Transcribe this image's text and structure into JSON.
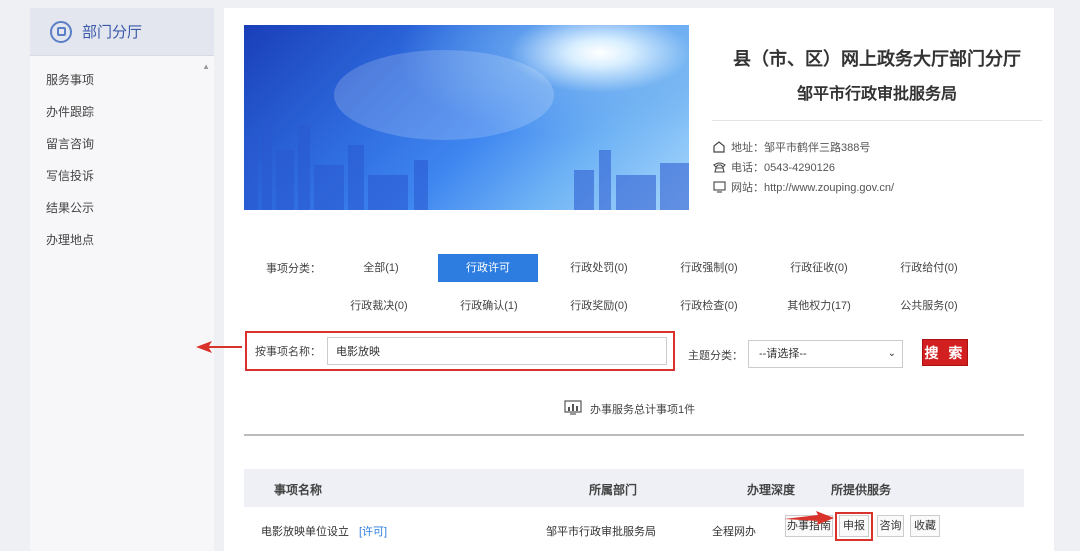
{
  "sidebar": {
    "title": "部门分厅",
    "items": [
      {
        "label": "服务事项"
      },
      {
        "label": "办件跟踪"
      },
      {
        "label": "留言咨询"
      },
      {
        "label": "写信投诉"
      },
      {
        "label": "结果公示"
      },
      {
        "label": "办理地点"
      }
    ]
  },
  "dept": {
    "title": "县（市、区）网上政务大厅部门分厅",
    "subtitle": "邹平市行政审批服务局",
    "address": "地址：邹平市鹤伴三路388号",
    "phone": "电话：0543-4290126",
    "website": "网站：http://www.zouping.gov.cn/"
  },
  "categories": {
    "label": "事项分类：",
    "items": [
      {
        "label": "全部(1)"
      },
      {
        "label": "行政许可"
      },
      {
        "label": "行政处罚(0)"
      },
      {
        "label": "行政强制(0)"
      },
      {
        "label": "行政征收(0)"
      },
      {
        "label": "行政给付(0)"
      },
      {
        "label": "行政裁决(0)"
      },
      {
        "label": "行政确认(1)"
      },
      {
        "label": "行政奖励(0)"
      },
      {
        "label": "行政检查(0)"
      },
      {
        "label": "其他权力(17)"
      },
      {
        "label": "公共服务(0)"
      }
    ],
    "active_index": 1
  },
  "search": {
    "name_label": "按事项名称：",
    "name_value": "电影放映",
    "theme_label": "主题分类：",
    "theme_value": "--请选择--",
    "button_label": "搜 索"
  },
  "summary": {
    "total_text": "办事服务总计事项1件"
  },
  "table": {
    "headers": [
      "事项名称",
      "所属部门",
      "办理深度",
      "所提供服务"
    ],
    "rows": [
      {
        "name": "电影放映单位设立",
        "tag": "[许可]",
        "dept": "邹平市行政审批服务局",
        "depth": "全程网办",
        "actions": [
          "办事指南",
          "申报",
          "咨询",
          "收藏"
        ]
      }
    ]
  },
  "colors": {
    "accent": "#2d7de0",
    "highlight": "#d9322b",
    "search_button": "#d21f1f"
  }
}
